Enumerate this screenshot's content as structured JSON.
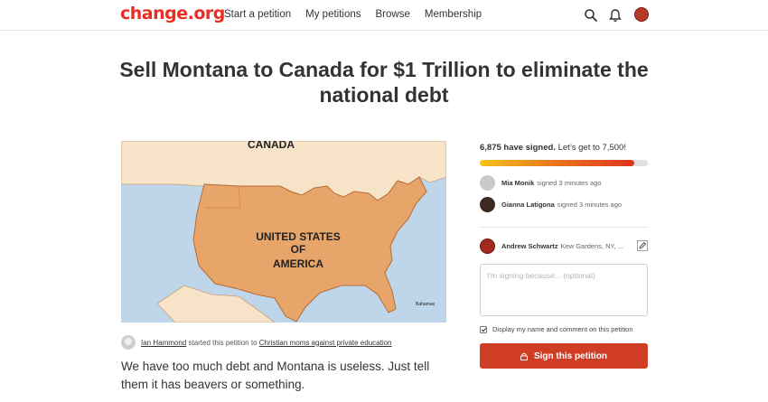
{
  "header": {
    "logo": "change.org",
    "nav": [
      "Start a petition",
      "My petitions",
      "Browse",
      "Membership"
    ],
    "icons": [
      "search-icon",
      "bell-icon",
      "user-avatar"
    ]
  },
  "petition": {
    "title": "Sell Montana to Canada for $1 Trillion to eliminate the national debt",
    "map_labels": {
      "canada": "CANADA",
      "usa_line1": "UNITED STATES",
      "usa_line2": "OF",
      "usa_line3": "AMERICA",
      "bahamas": "Bahamas"
    },
    "starter_name": "Ian Hammond",
    "starter_text": " started this petition to ",
    "recipient": "Christian moms against private education",
    "description": "We have too much debt and Montana is useless. Just tell them it has beavers or something."
  },
  "sidebar": {
    "signed_count": "6,875 have signed.",
    "goal_text": " Let’s get to 7,500!",
    "progress_fraction": 0.9167,
    "recent_signers": [
      {
        "name": "Mia Monik",
        "when": "signed 3 minutes ago"
      },
      {
        "name": "Gianna Latigona",
        "when": "signed 3 minutes ago"
      }
    ],
    "me": {
      "name": "Andrew Schwartz",
      "location": "Kew Gardens, NY, ..."
    },
    "reason_placeholder": "I'm signing because... (optional)",
    "display_label": "Display my name and comment on this petition",
    "sign_button": "Sign this petition"
  },
  "colors": {
    "brand": "#ec2c22",
    "button": "#cf3d24",
    "usa_fill": "#e8a56a",
    "canada_fill": "#f6e3c8",
    "water": "#bfd6ea"
  }
}
